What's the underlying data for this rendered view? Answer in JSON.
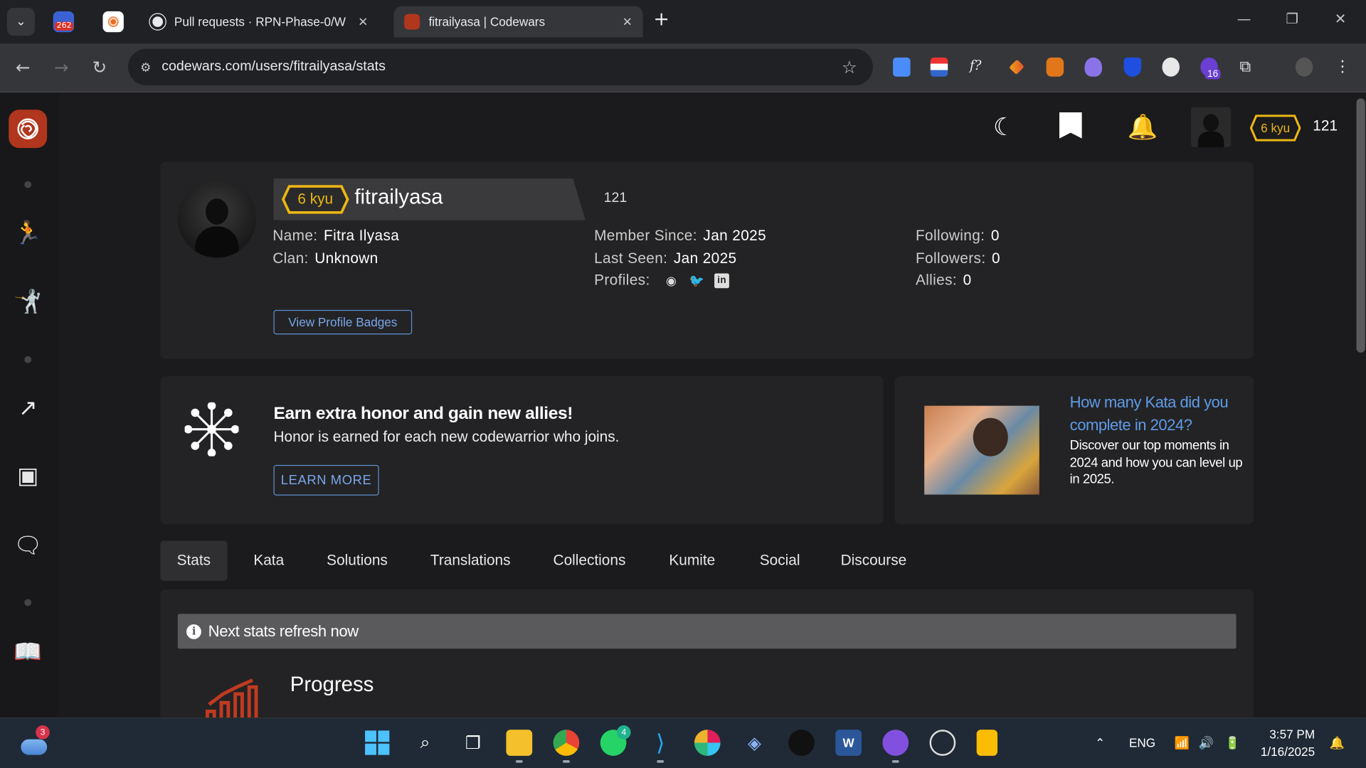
{
  "browser": {
    "pinned_badge": "262",
    "tabs": [
      {
        "label": "Pull requests · RPN-Phase-0/W",
        "close": "✕"
      },
      {
        "label": "fitrailyasa | Codewars",
        "close": "✕"
      }
    ],
    "new_tab": "+",
    "window_controls": {
      "minimize": "—",
      "restore": "❐",
      "close": "✕"
    },
    "url": "codewars.com/users/fitrailyasa/stats",
    "extension_badge": "16"
  },
  "topbar": {
    "rank": "6 kyu",
    "honor": "121"
  },
  "profile": {
    "rank": "6 kyu",
    "username": "fitrailyasa",
    "honor": "121",
    "fields": {
      "name_label": "Name:",
      "name": "Fitra Ilyasa",
      "clan_label": "Clan:",
      "clan": "Unknown",
      "member_since_label": "Member Since:",
      "member_since": "Jan 2025",
      "last_seen_label": "Last Seen:",
      "last_seen": "Jan 2025",
      "profiles_label": "Profiles:",
      "following_label": "Following:",
      "following": "0",
      "followers_label": "Followers:",
      "followers": "0",
      "allies_label": "Allies:",
      "allies": "0"
    },
    "badges_button": "View Profile Badges"
  },
  "banner": {
    "title": "Earn extra honor and gain new allies!",
    "subtitle": "Honor is earned for each new codewarrior who joins.",
    "button": "LEARN MORE"
  },
  "promo": {
    "title": "How many Kata did you complete in 2024?",
    "text": "Discover our top moments in 2024 and how you can level up in 2025."
  },
  "tabs": [
    "Stats",
    "Kata",
    "Solutions",
    "Translations",
    "Collections",
    "Kumite",
    "Social",
    "Discourse"
  ],
  "stats": {
    "refresh": "Next stats refresh now",
    "progress_title": "Progress"
  },
  "taskbar": {
    "weather_badge": "3",
    "whatsapp_badge": "4",
    "lang": "ENG",
    "time": "3:57 PM",
    "date": "1/16/2025"
  },
  "colors": {
    "brand": "#b1361e",
    "kyu_yellow": "#ecb613",
    "link_blue": "#5f9be8",
    "card": "#232325",
    "page": "#1b1b1d"
  }
}
